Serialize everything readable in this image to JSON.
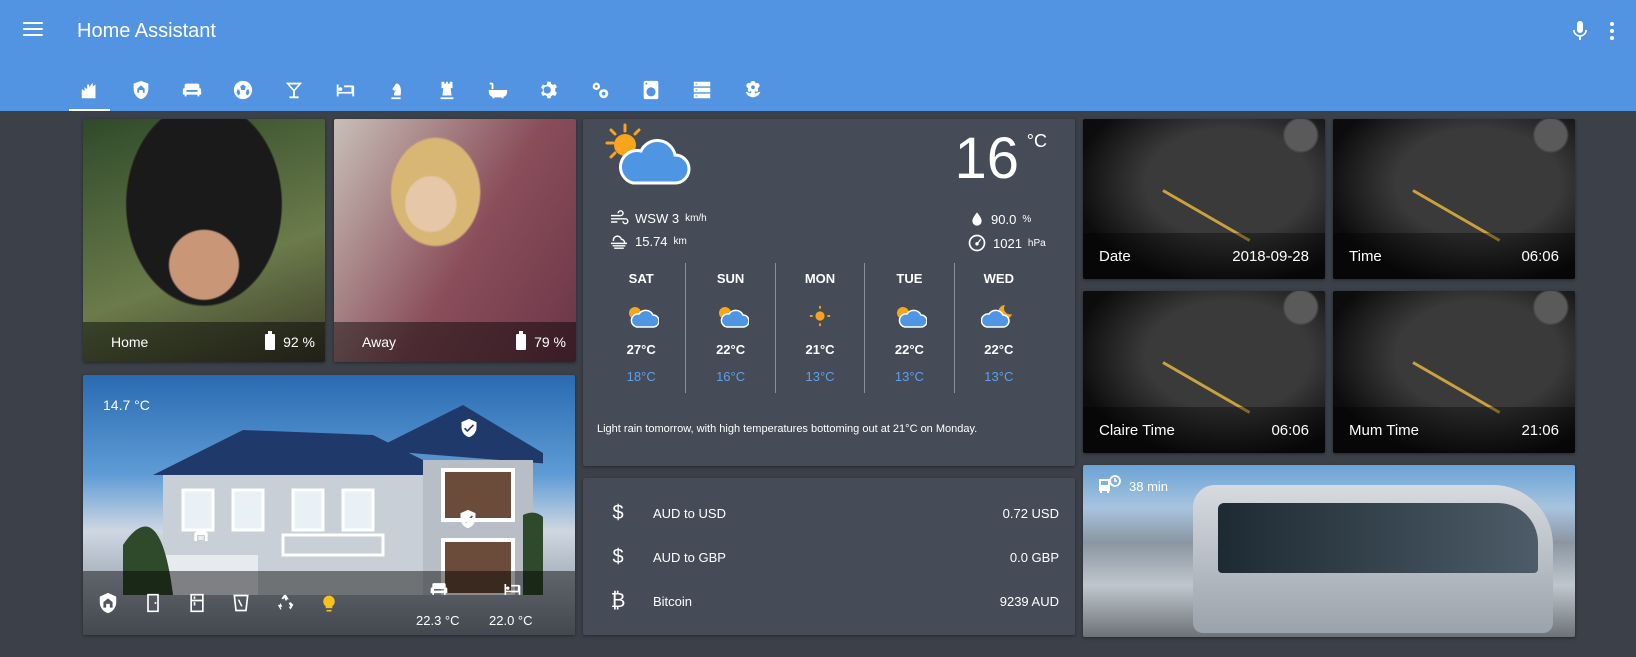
{
  "header": {
    "title": "Home Assistant",
    "tabs": [
      "home",
      "security",
      "lounge",
      "sports",
      "cocktail",
      "bedroom",
      "chess-knight",
      "chess-rook",
      "bathroom",
      "settings",
      "settings-multi",
      "washing-machine",
      "server",
      "flower"
    ]
  },
  "people": [
    {
      "state": "Home",
      "battery": "92 %"
    },
    {
      "state": "Away",
      "battery": "79 %"
    }
  ],
  "house": {
    "outdoor_temp": "14.7 °C",
    "sensor_1": "22.3 °C",
    "sensor_2": "22.0 °C"
  },
  "weather": {
    "temp": "16",
    "unit": "°C",
    "wind": "WSW 3",
    "wind_unit": "km/h",
    "visibility": "15.74",
    "visibility_unit": "km",
    "humidity": "90.0",
    "humidity_unit": "%",
    "pressure": "1021",
    "pressure_unit": "hPa",
    "forecast": [
      {
        "day": "SAT",
        "hi": "27°C",
        "lo": "18°C",
        "icon": "partly-cloudy"
      },
      {
        "day": "SUN",
        "hi": "22°C",
        "lo": "16°C",
        "icon": "partly-cloudy"
      },
      {
        "day": "MON",
        "hi": "21°C",
        "lo": "13°C",
        "icon": "sunny"
      },
      {
        "day": "TUE",
        "hi": "22°C",
        "lo": "13°C",
        "icon": "partly-cloudy"
      },
      {
        "day": "WED",
        "hi": "22°C",
        "lo": "13°C",
        "icon": "partly-cloudy-night"
      }
    ],
    "summary": "Light rain tomorrow, with high temperatures bottoming out at 21°C on Monday."
  },
  "currency": [
    {
      "label": "AUD to USD",
      "value": "0.72 USD",
      "icon": "dollar-icon"
    },
    {
      "label": "AUD to GBP",
      "value": "0.0 GBP",
      "icon": "dollar-icon"
    },
    {
      "label": "Bitcoin",
      "value": "9239 AUD",
      "icon": "bitcoin-icon"
    }
  ],
  "clocks": [
    {
      "label": "Date",
      "value": "2018-09-28"
    },
    {
      "label": "Time",
      "value": "06:06"
    },
    {
      "label": "Claire Time",
      "value": "06:06"
    },
    {
      "label": "Mum Time",
      "value": "21:06"
    }
  ],
  "bus": {
    "eta": "38 min"
  }
}
